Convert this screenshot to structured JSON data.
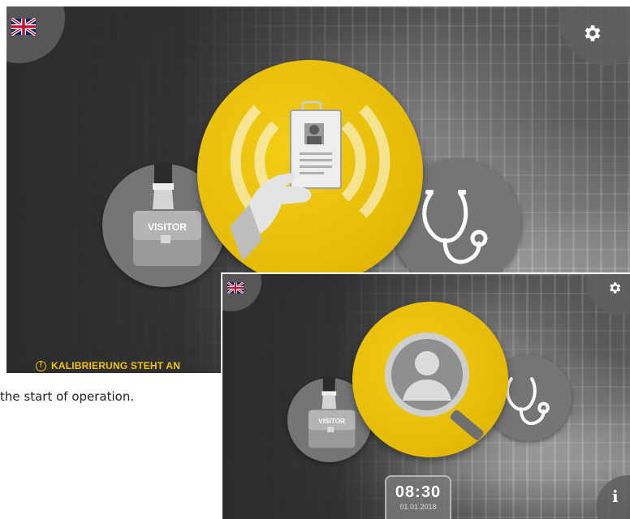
{
  "screen1": {
    "language_flag": "uk-flag-icon",
    "settings_icon": "gear-icon",
    "visitor_label": "VISITOR",
    "center_icon": "id-badge-rfid-icon",
    "medical_icon": "stethoscope-icon",
    "warning_text": "KALIBRIERUNG STEHT AN",
    "warning_color": "#f2c500"
  },
  "caption": {
    "text": "the start of operation."
  },
  "screen2": {
    "language_flag": "uk-flag-icon",
    "settings_icon": "gear-icon",
    "visitor_label": "VISITOR",
    "center_icon": "face-search-icon",
    "medical_icon": "stethoscope-icon",
    "info_icon": "info-icon",
    "clock_time": "08:30",
    "clock_date": "01.01.2018"
  },
  "colors": {
    "accent_yellow": "#e6bd08",
    "screen_dark": "#2c2c2c",
    "circle_gray": "#757575"
  }
}
